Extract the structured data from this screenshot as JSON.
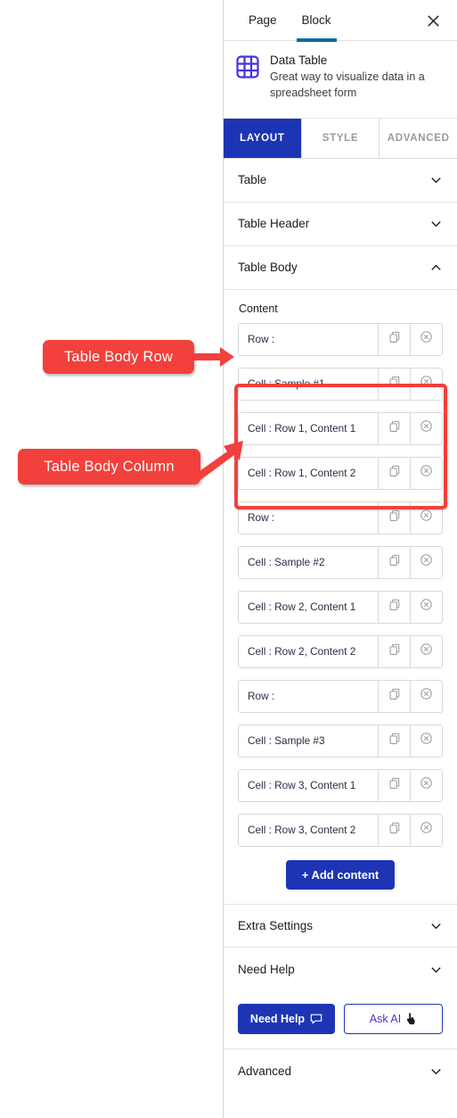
{
  "panel": {
    "top_tabs": [
      {
        "label": "Page",
        "active": false
      },
      {
        "label": "Block",
        "active": true
      }
    ],
    "close_icon": "close-icon",
    "block": {
      "icon": "data-table-icon",
      "title": "Data Table",
      "description": "Great way to visualize data in a spreadsheet form"
    },
    "segment_tabs": [
      {
        "label": "LAYOUT",
        "active": true
      },
      {
        "label": "STYLE",
        "active": false
      },
      {
        "label": "ADVANCED",
        "active": false
      }
    ],
    "sections": [
      {
        "title": "Table",
        "state": "collapsed",
        "chevron": "chevron-down-icon"
      },
      {
        "title": "Table Header",
        "state": "collapsed",
        "chevron": "chevron-down-icon"
      },
      {
        "title": "Table Body",
        "state": "expanded",
        "chevron": "chevron-up-icon"
      }
    ],
    "content": {
      "label": "Content",
      "items": [
        {
          "label": "Row :",
          "copy_icon": "duplicate-icon",
          "delete_icon": "remove-circle-icon"
        },
        {
          "label": "Cell : Sample #1",
          "copy_icon": "duplicate-icon",
          "delete_icon": "remove-circle-icon"
        },
        {
          "label": "Cell : Row 1, Content 1",
          "copy_icon": "duplicate-icon",
          "delete_icon": "remove-circle-icon"
        },
        {
          "label": "Cell : Row 1, Content 2",
          "copy_icon": "duplicate-icon",
          "delete_icon": "remove-circle-icon"
        },
        {
          "label": "Row :",
          "copy_icon": "duplicate-icon",
          "delete_icon": "remove-circle-icon"
        },
        {
          "label": "Cell : Sample #2",
          "copy_icon": "duplicate-icon",
          "delete_icon": "remove-circle-icon"
        },
        {
          "label": "Cell : Row 2, Content 1",
          "copy_icon": "duplicate-icon",
          "delete_icon": "remove-circle-icon"
        },
        {
          "label": "Cell : Row 2, Content 2",
          "copy_icon": "duplicate-icon",
          "delete_icon": "remove-circle-icon"
        },
        {
          "label": "Row :",
          "copy_icon": "duplicate-icon",
          "delete_icon": "remove-circle-icon"
        },
        {
          "label": "Cell : Sample #3",
          "copy_icon": "duplicate-icon",
          "delete_icon": "remove-circle-icon"
        },
        {
          "label": "Cell : Row 3, Content 1",
          "copy_icon": "duplicate-icon",
          "delete_icon": "remove-circle-icon"
        },
        {
          "label": "Cell : Row 3, Content 2",
          "copy_icon": "duplicate-icon",
          "delete_icon": "remove-circle-icon"
        }
      ],
      "add_button": "+ Add content"
    },
    "footer_sections": [
      {
        "title": "Extra Settings",
        "chevron": "chevron-down-icon"
      },
      {
        "title": "Need Help",
        "chevron": "chevron-down-icon"
      }
    ],
    "help_buttons": {
      "need_help": "Need Help",
      "need_help_icon": "speech-bubble-icon",
      "ask_ai": "Ask AI",
      "ask_ai_icon": "pointing-hand-icon"
    },
    "advanced_section": {
      "title": "Advanced",
      "chevron": "chevron-down-icon"
    }
  },
  "annotations": [
    {
      "label": "Table Body Row",
      "target": "row-item-0",
      "arrow": "straight-right"
    },
    {
      "label": "Table Body Column",
      "target": "cell-group-row-1",
      "arrow": "diagonal-up-right"
    }
  ],
  "colors": {
    "accent_blue": "#1d35b4",
    "tab_underline": "#0b6c9e",
    "annotation_red": "#f2403c",
    "icon_purple": "#4535d8",
    "panel_border": "#d6d6d6"
  }
}
